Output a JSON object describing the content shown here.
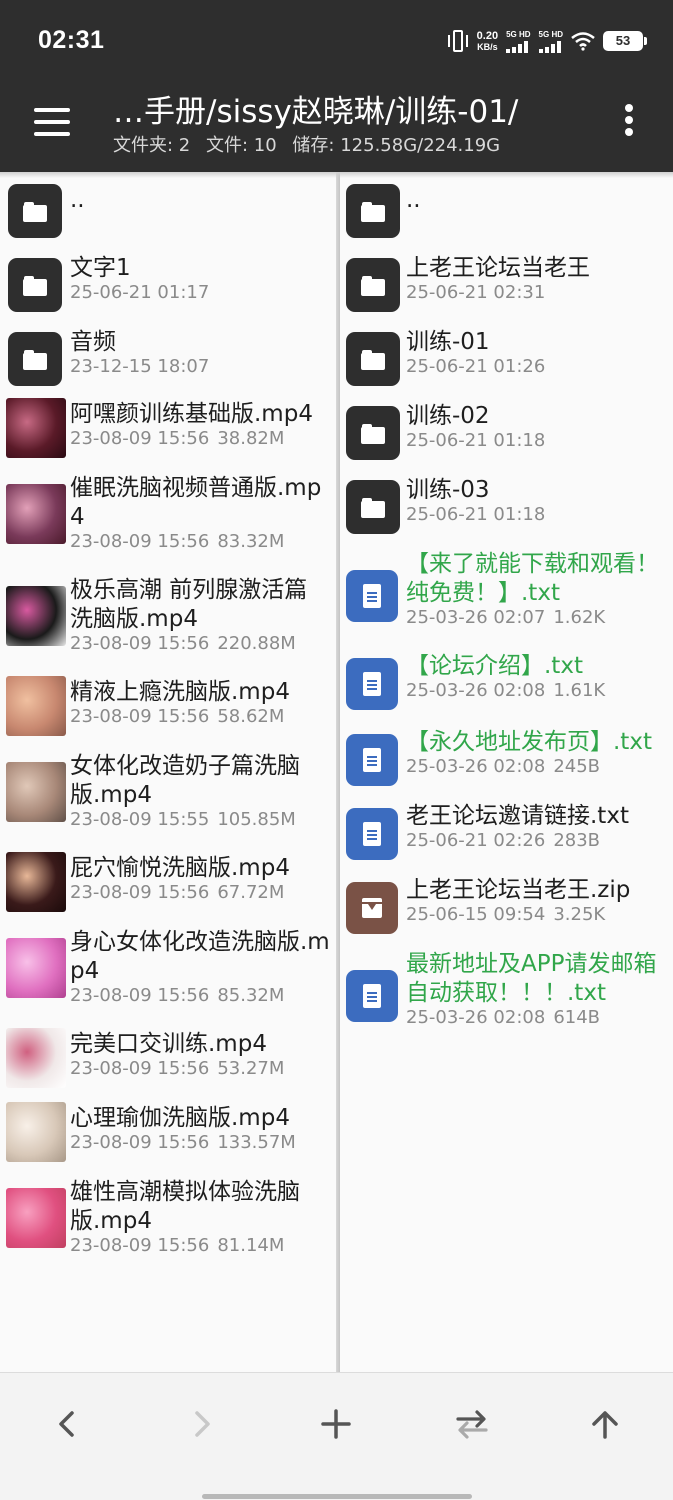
{
  "status_bar": {
    "time": "02:31",
    "speed_value": "0.20",
    "speed_unit": "KB/s",
    "sim1_label": "5G HD",
    "sim2_label": "5G HD",
    "battery": "53",
    "icons": [
      "vibrate-icon",
      "signal-icon",
      "signal-icon",
      "wifi-icon",
      "battery-icon"
    ]
  },
  "toolbar": {
    "menu_icon": "hamburger-menu-icon",
    "path": "…手册/sissy赵晓琳/训练-01/",
    "folders_stat": "文件夹: 2",
    "files_stat": "文件: 10",
    "storage_stat": "储存: 125.58G/224.19G",
    "more_icon": "more-vertical-icon"
  },
  "left_pane": {
    "items": [
      {
        "name": "..",
        "meta_date": "",
        "meta_size": "",
        "icon": "folder-icon"
      },
      {
        "name": "文字1",
        "meta_date": "25-06-21 01:17",
        "meta_size": "",
        "icon": "folder-icon"
      },
      {
        "name": "音频",
        "meta_date": "23-12-15 18:07",
        "meta_size": "",
        "icon": "folder-icon"
      },
      {
        "name": "阿嘿颜训练基础版.mp4",
        "meta_date": "23-08-09 15:56",
        "meta_size": "38.82M",
        "icon": "video-thumbnail"
      },
      {
        "name": "催眠洗脑视频普通版.mp4",
        "meta_date": "23-08-09 15:56",
        "meta_size": "83.32M",
        "icon": "video-thumbnail"
      },
      {
        "name": "极乐高潮 前列腺激活篇洗脑版.mp4",
        "meta_date": "23-08-09 15:56",
        "meta_size": "220.88M",
        "icon": "video-thumbnail"
      },
      {
        "name": "精液上瘾洗脑版.mp4",
        "meta_date": "23-08-09 15:56",
        "meta_size": "58.62M",
        "icon": "video-thumbnail"
      },
      {
        "name": "女体化改造奶子篇洗脑版.mp4",
        "meta_date": "23-08-09 15:55",
        "meta_size": "105.85M",
        "icon": "video-thumbnail"
      },
      {
        "name": "屁穴愉悦洗脑版.mp4",
        "meta_date": "23-08-09 15:56",
        "meta_size": "67.72M",
        "icon": "video-thumbnail"
      },
      {
        "name": "身心女体化改造洗脑版.mp4",
        "meta_date": "23-08-09 15:56",
        "meta_size": "85.32M",
        "icon": "video-thumbnail"
      },
      {
        "name": "完美口交训练.mp4",
        "meta_date": "23-08-09 15:56",
        "meta_size": "53.27M",
        "icon": "video-thumbnail"
      },
      {
        "name": "心理瑜伽洗脑版.mp4",
        "meta_date": "23-08-09 15:56",
        "meta_size": "133.57M",
        "icon": "video-thumbnail"
      },
      {
        "name": "雄性高潮模拟体验洗脑版.mp4",
        "meta_date": "23-08-09 15:56",
        "meta_size": "81.14M",
        "icon": "video-thumbnail"
      }
    ]
  },
  "right_pane": {
    "items": [
      {
        "name": "..",
        "meta_date": "",
        "meta_size": "",
        "icon": "folder-icon"
      },
      {
        "name": "上老王论坛当老王",
        "meta_date": "25-06-21 02:31",
        "meta_size": "",
        "icon": "folder-icon"
      },
      {
        "name": "训练-01",
        "meta_date": "25-06-21 01:26",
        "meta_size": "",
        "icon": "folder-icon"
      },
      {
        "name": "训练-02",
        "meta_date": "25-06-21 01:18",
        "meta_size": "",
        "icon": "folder-icon"
      },
      {
        "name": "训练-03",
        "meta_date": "25-06-21 01:18",
        "meta_size": "",
        "icon": "folder-icon"
      },
      {
        "name": "【来了就能下载和观看！纯免费！】.txt",
        "meta_date": "25-03-26 02:07",
        "meta_size": "1.62K",
        "icon": "text-file-icon"
      },
      {
        "name": "【论坛介绍】.txt",
        "meta_date": "25-03-26 02:08",
        "meta_size": "1.61K",
        "icon": "text-file-icon"
      },
      {
        "name": "【永久地址发布页】.txt",
        "meta_date": "25-03-26 02:08",
        "meta_size": "245B",
        "icon": "text-file-icon"
      },
      {
        "name": "老王论坛邀请链接.txt",
        "meta_date": "25-06-21 02:26",
        "meta_size": "283B",
        "icon": "text-file-icon"
      },
      {
        "name": "上老王论坛当老王.zip",
        "meta_date": "25-06-15 09:54",
        "meta_size": "3.25K",
        "icon": "archive-icon"
      },
      {
        "name": "最新地址及APP请发邮箱自动获取！！！.txt",
        "meta_date": "25-03-26 02:08",
        "meta_size": "614B",
        "icon": "text-file-icon"
      }
    ]
  },
  "bottom_bar": {
    "buttons": [
      "back-arrow-icon",
      "forward-arrow-icon",
      "add-icon",
      "swap-panes-icon",
      "parent-folder-icon"
    ]
  },
  "colors": {
    "toolbar_bg": "#2e2e2e",
    "highlight_text": "#31a64a",
    "doc_icon": "#3c6cbf",
    "archive_icon": "#7a5246"
  }
}
